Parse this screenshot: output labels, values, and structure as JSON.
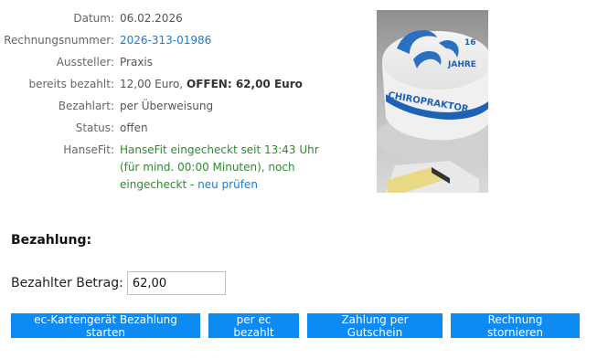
{
  "invoice": {
    "rows": [
      {
        "label": "Datum:",
        "value": "06.02.2026"
      },
      {
        "label": "Rechnungsnummer:",
        "value": "2026-313-01986"
      },
      {
        "label": "Aussteller:",
        "value": "Praxis"
      },
      {
        "label": "bereits bezahlt:",
        "value_plain": "12,00 Euro, ",
        "value_bold": "OFFEN: 62,00 Euro"
      },
      {
        "label": "Bezahlart:",
        "value": "per Überweisung"
      },
      {
        "label": "Status:",
        "value": "offen"
      },
      {
        "label": "HanseFit:",
        "value": "HanseFit eingecheckt seit 13:43 Uhr (für mind. 00:00 Minuten), noch eingecheckt -",
        "link": "neu prüfen"
      }
    ]
  },
  "photo": {
    "cake_text_1": "16",
    "cake_text_2": "JAHRE",
    "cake_text_3": "CHIROPRAKTOR"
  },
  "payment": {
    "title": "Bezahlung:",
    "amount_label": "Bezahlter Betrag:",
    "amount_value": "62,00"
  },
  "buttons": {
    "ec_terminal": "ec-Kartengerät Bezahlung starten",
    "ec_paid": "per ec bezahlt",
    "voucher": "Zahlung per Gutschein",
    "cancel": "Rechnung stornieren"
  },
  "colors": {
    "accent": "#0e8bf2",
    "link": "#1a7bd6",
    "status_green": "#2e8b2e"
  }
}
